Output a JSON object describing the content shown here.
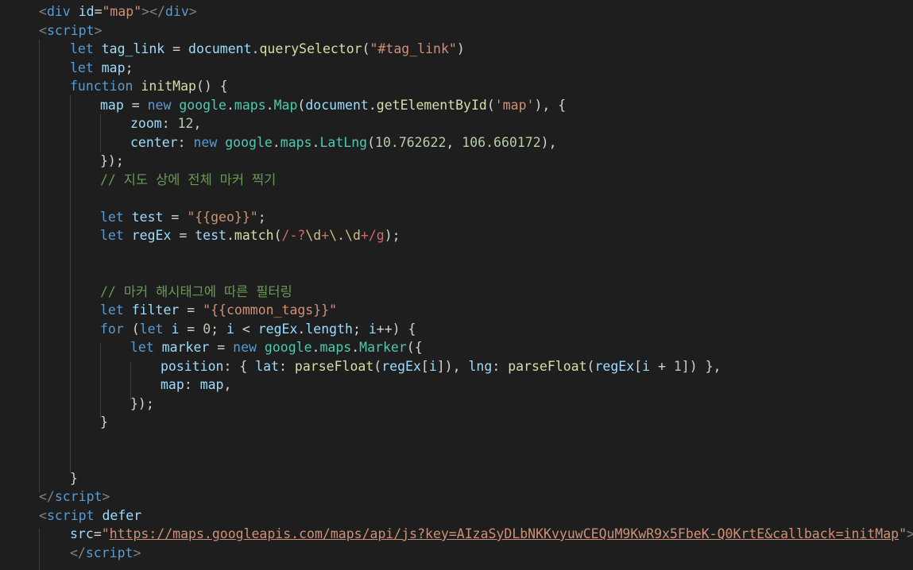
{
  "editor": {
    "language": "html",
    "theme_colors": {
      "background": "#1e1e1e",
      "tag": "#569cd6",
      "string": "#ce9178",
      "keyword": "#569cd6",
      "variable": "#9cdcfe",
      "function": "#dcdcaa",
      "class": "#4ec9b0",
      "number": "#b5cea8",
      "comment": "#6a9955",
      "regex": "#d16969"
    },
    "lines": [
      [
        [
          "bracket",
          "<"
        ],
        [
          "tag",
          "div"
        ],
        [
          "plain",
          " "
        ],
        [
          "attr",
          "id"
        ],
        [
          "plain",
          "="
        ],
        [
          "str",
          "\"map\""
        ],
        [
          "bracket",
          "></"
        ],
        [
          "tag",
          "div"
        ],
        [
          "bracket",
          ">"
        ]
      ],
      [
        [
          "bracket",
          "<"
        ],
        [
          "tag",
          "script"
        ],
        [
          "bracket",
          ">"
        ]
      ],
      [
        [
          "kw",
          "let"
        ],
        [
          "plain",
          " "
        ],
        [
          "var",
          "tag_link"
        ],
        [
          "plain",
          " = "
        ],
        [
          "var",
          "document"
        ],
        [
          "plain",
          "."
        ],
        [
          "fn",
          "querySelector"
        ],
        [
          "plain",
          "("
        ],
        [
          "str",
          "\"#tag_link\""
        ],
        [
          "plain",
          ")"
        ]
      ],
      [
        [
          "kw",
          "let"
        ],
        [
          "plain",
          " "
        ],
        [
          "var",
          "map"
        ],
        [
          "plain",
          ";"
        ]
      ],
      [
        [
          "kw",
          "function"
        ],
        [
          "plain",
          " "
        ],
        [
          "fn",
          "initMap"
        ],
        [
          "plain",
          "() {"
        ]
      ],
      [
        [
          "var",
          "map"
        ],
        [
          "plain",
          " = "
        ],
        [
          "kw",
          "new"
        ],
        [
          "plain",
          " "
        ],
        [
          "cls",
          "google"
        ],
        [
          "plain",
          "."
        ],
        [
          "cls",
          "maps"
        ],
        [
          "plain",
          "."
        ],
        [
          "cls",
          "Map"
        ],
        [
          "plain",
          "("
        ],
        [
          "var",
          "document"
        ],
        [
          "plain",
          "."
        ],
        [
          "fn",
          "getElementById"
        ],
        [
          "plain",
          "("
        ],
        [
          "str",
          "'map'"
        ],
        [
          "plain",
          "), {"
        ]
      ],
      [
        [
          "var",
          "zoom"
        ],
        [
          "plain",
          ": "
        ],
        [
          "num",
          "12"
        ],
        [
          "plain",
          ","
        ]
      ],
      [
        [
          "var",
          "center"
        ],
        [
          "plain",
          ": "
        ],
        [
          "kw",
          "new"
        ],
        [
          "plain",
          " "
        ],
        [
          "cls",
          "google"
        ],
        [
          "plain",
          "."
        ],
        [
          "cls",
          "maps"
        ],
        [
          "plain",
          "."
        ],
        [
          "cls",
          "LatLng"
        ],
        [
          "plain",
          "("
        ],
        [
          "num",
          "10.762622"
        ],
        [
          "plain",
          ", "
        ],
        [
          "num",
          "106.660172"
        ],
        [
          "plain",
          "),"
        ]
      ],
      [
        [
          "plain",
          "});"
        ]
      ],
      [
        [
          "cmt",
          "// 지도 상에 전체 마커 찍기"
        ]
      ],
      [],
      [
        [
          "kw",
          "let"
        ],
        [
          "plain",
          " "
        ],
        [
          "var",
          "test"
        ],
        [
          "plain",
          " = "
        ],
        [
          "str",
          "\"{{geo}}\""
        ],
        [
          "plain",
          ";"
        ]
      ],
      [
        [
          "kw",
          "let"
        ],
        [
          "plain",
          " "
        ],
        [
          "var",
          "regEx"
        ],
        [
          "plain",
          " = "
        ],
        [
          "var",
          "test"
        ],
        [
          "plain",
          "."
        ],
        [
          "fn",
          "match"
        ],
        [
          "plain",
          "("
        ],
        [
          "rx",
          "/-?"
        ],
        [
          "rxc",
          "\\d"
        ],
        [
          "rx",
          "+"
        ],
        [
          "rxc",
          "\\."
        ],
        [
          "rxc",
          "\\d"
        ],
        [
          "rx",
          "+/g"
        ],
        [
          "plain",
          ");"
        ]
      ],
      [],
      [],
      [
        [
          "cmt",
          "// 마커 해시태그에 따른 필터링"
        ]
      ],
      [
        [
          "kw",
          "let"
        ],
        [
          "plain",
          " "
        ],
        [
          "var",
          "filter"
        ],
        [
          "plain",
          " = "
        ],
        [
          "str",
          "\"{{common_tags}}\""
        ]
      ],
      [
        [
          "kw",
          "for"
        ],
        [
          "plain",
          " ("
        ],
        [
          "kw",
          "let"
        ],
        [
          "plain",
          " "
        ],
        [
          "var",
          "i"
        ],
        [
          "plain",
          " = "
        ],
        [
          "num",
          "0"
        ],
        [
          "plain",
          "; "
        ],
        [
          "var",
          "i"
        ],
        [
          "plain",
          " < "
        ],
        [
          "var",
          "regEx"
        ],
        [
          "plain",
          "."
        ],
        [
          "var",
          "length"
        ],
        [
          "plain",
          "; "
        ],
        [
          "var",
          "i"
        ],
        [
          "plain",
          "++) {"
        ]
      ],
      [
        [
          "kw",
          "let"
        ],
        [
          "plain",
          " "
        ],
        [
          "var",
          "marker"
        ],
        [
          "plain",
          " = "
        ],
        [
          "kw",
          "new"
        ],
        [
          "plain",
          " "
        ],
        [
          "cls",
          "google"
        ],
        [
          "plain",
          "."
        ],
        [
          "cls",
          "maps"
        ],
        [
          "plain",
          "."
        ],
        [
          "cls",
          "Marker"
        ],
        [
          "plain",
          "({"
        ]
      ],
      [
        [
          "var",
          "position"
        ],
        [
          "plain",
          ": { "
        ],
        [
          "var",
          "lat"
        ],
        [
          "plain",
          ": "
        ],
        [
          "fn",
          "parseFloat"
        ],
        [
          "plain",
          "("
        ],
        [
          "var",
          "regEx"
        ],
        [
          "plain",
          "["
        ],
        [
          "var",
          "i"
        ],
        [
          "plain",
          "]), "
        ],
        [
          "var",
          "lng"
        ],
        [
          "plain",
          ": "
        ],
        [
          "fn",
          "parseFloat"
        ],
        [
          "plain",
          "("
        ],
        [
          "var",
          "regEx"
        ],
        [
          "plain",
          "["
        ],
        [
          "var",
          "i"
        ],
        [
          "plain",
          " + "
        ],
        [
          "num",
          "1"
        ],
        [
          "plain",
          "]) },"
        ]
      ],
      [
        [
          "var",
          "map"
        ],
        [
          "plain",
          ": "
        ],
        [
          "var",
          "map"
        ],
        [
          "plain",
          ","
        ]
      ],
      [
        [
          "plain",
          "});"
        ]
      ],
      [
        [
          "plain",
          "}"
        ]
      ],
      [],
      [],
      [
        [
          "plain",
          "}"
        ]
      ],
      [
        [
          "bracket",
          "</"
        ],
        [
          "tag",
          "script"
        ],
        [
          "bracket",
          ">"
        ]
      ],
      [
        [
          "bracket",
          "<"
        ],
        [
          "tag",
          "script"
        ],
        [
          "plain",
          " "
        ],
        [
          "attr",
          "defer"
        ]
      ],
      [
        [
          "attr",
          "src"
        ],
        [
          "plain",
          "="
        ],
        [
          "str",
          "\""
        ],
        [
          "url",
          "https://maps.googleapis.com/maps/api/js?key=AIzaSyDLbNKKvyuwCEQuM9KwR9x5FbeK-Q0KrtE&callback=initMap"
        ],
        [
          "str",
          "\""
        ],
        [
          "bracket",
          ">"
        ]
      ],
      [
        [
          "bracket",
          "</"
        ],
        [
          "tag",
          "script"
        ],
        [
          "bracket",
          ">"
        ]
      ]
    ]
  }
}
